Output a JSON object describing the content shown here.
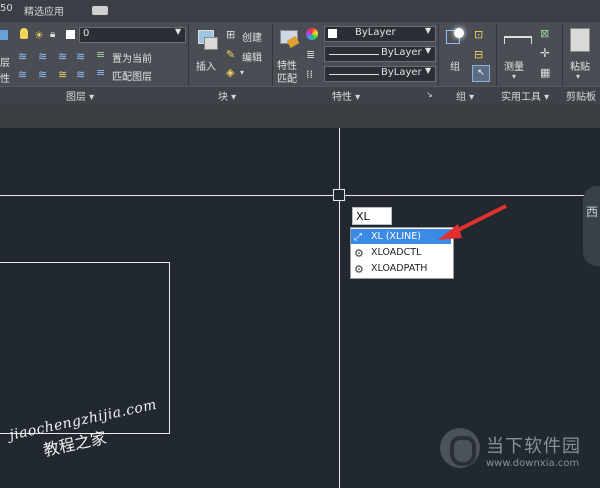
{
  "tabs": {
    "partial": "50",
    "fav": "精选应用"
  },
  "layers": {
    "current_layer": "0",
    "left_labels": [
      "层",
      "性"
    ],
    "set_current": "置为当前",
    "match_layer": "匹配图层",
    "panel_label": "图层 ▾"
  },
  "block": {
    "insert": "插入",
    "create": "创建",
    "edit": "编辑",
    "panel_label": "块 ▾"
  },
  "properties": {
    "match_line1": "特性",
    "match_line2": "匹配",
    "color": "ByLayer",
    "linetype": "ByLayer",
    "lineweight": "ByLayer",
    "panel_label": "特性 ▾",
    "launcher": "↘"
  },
  "group": {
    "label": "组",
    "panel_label": "组 ▾"
  },
  "utilities": {
    "measure": "测量",
    "panel_label": "实用工具 ▾"
  },
  "clipboard": {
    "paste": "粘贴",
    "panel_label": "剪贴板"
  },
  "canvas": {
    "command_input": "XL",
    "side_label": "西",
    "autocomplete": [
      "XL (XLINE)",
      "XLOADCTL",
      "XLOADPATH"
    ]
  },
  "watermarks": {
    "left_url": "jiaochengzhijia.com",
    "left_cn": "教程之家",
    "right_cn": "当下软件园",
    "right_url": "www.downxia.com"
  },
  "colors": {
    "canvas": "#212830",
    "ribbon": "#4a4e54",
    "selection": "#3b8ae6",
    "arrow": "#e03030"
  }
}
